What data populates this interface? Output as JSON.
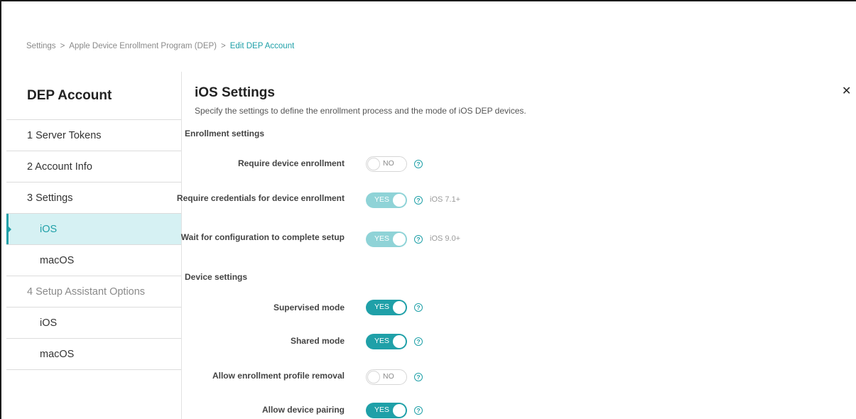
{
  "breadcrumb": {
    "items": [
      "Settings",
      "Apple Device Enrollment Program (DEP)"
    ],
    "separator": ">",
    "current": "Edit DEP Account"
  },
  "sidebar": {
    "title": "DEP Account",
    "items": [
      {
        "label": "1 Server Tokens",
        "type": "step"
      },
      {
        "label": "2 Account Info",
        "type": "step"
      },
      {
        "label": "3 Settings",
        "type": "step"
      },
      {
        "label": "iOS",
        "type": "sub",
        "active": true
      },
      {
        "label": "macOS",
        "type": "sub"
      },
      {
        "label": "4 Setup Assistant Options",
        "type": "step",
        "disabled": true
      },
      {
        "label": "iOS",
        "type": "sub"
      },
      {
        "label": "macOS",
        "type": "sub"
      }
    ]
  },
  "main": {
    "title": "iOS Settings",
    "description": "Specify the settings to define the enrollment process and the mode of iOS DEP devices.",
    "close_icon": "close-icon",
    "help_glyph": "?",
    "sections": {
      "enrollment": {
        "title": "Enrollment settings",
        "rows": [
          {
            "label": "Require device enrollment",
            "state": "NO",
            "enabled": false,
            "note": ""
          },
          {
            "label": "Require credentials for device enrollment",
            "state": "YES",
            "enabled": false,
            "note": "iOS 7.1+"
          },
          {
            "label": "Wait for configuration to complete setup",
            "state": "YES",
            "enabled": false,
            "note": "iOS 9.0+"
          }
        ]
      },
      "device": {
        "title": "Device settings",
        "rows": [
          {
            "label": "Supervised mode",
            "state": "YES",
            "enabled": true
          },
          {
            "label": "Shared mode",
            "state": "YES",
            "enabled": true
          },
          {
            "label": "Allow enrollment profile removal",
            "state": "NO",
            "enabled": true
          },
          {
            "label": "Allow device pairing",
            "state": "YES",
            "enabled": true
          }
        ]
      }
    }
  },
  "colors": {
    "accent": "#1fa0a8",
    "accent_disabled": "#8fd3d7",
    "active_bg": "#d6f1f3"
  }
}
